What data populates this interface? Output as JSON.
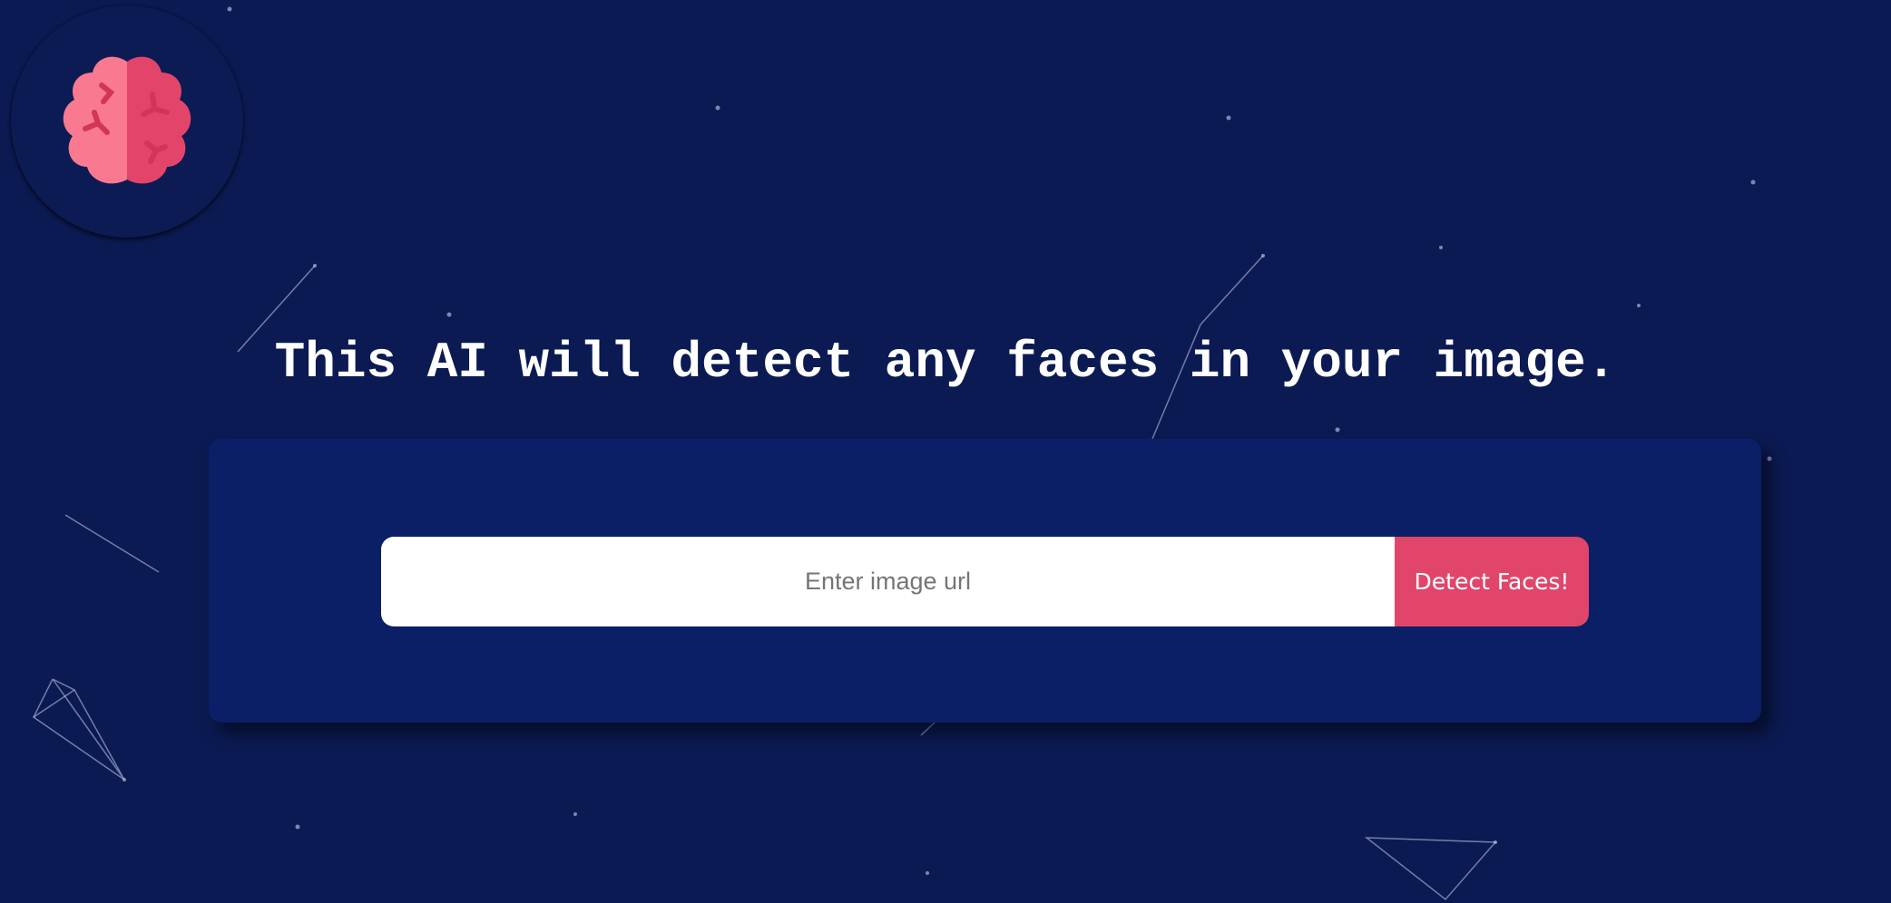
{
  "logo": {
    "icon": "brain-icon",
    "colors": {
      "left": "#f97a90",
      "right": "#e3456a",
      "detail": "#d13658"
    }
  },
  "headline": "This AI will detect any faces in your image.",
  "form": {
    "input_placeholder": "Enter image url",
    "input_value": "",
    "button_label": "Detect Faces!"
  },
  "theme": {
    "background": "#0b1a52",
    "card": "#0a1f66",
    "accent": "#e2456a"
  }
}
